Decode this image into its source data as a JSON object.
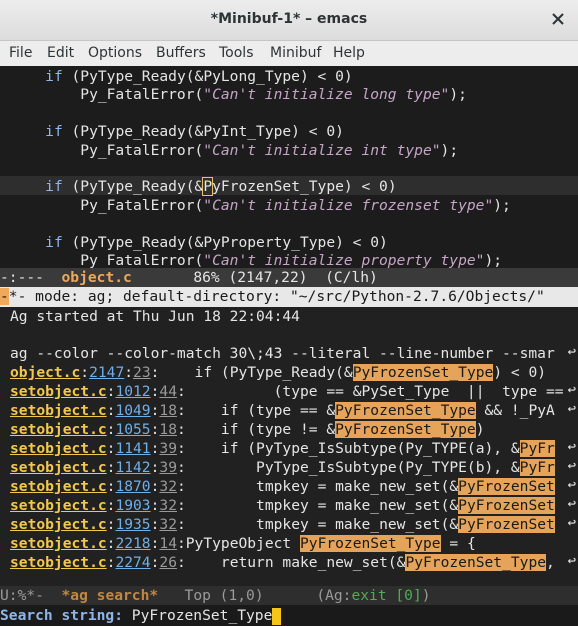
{
  "window": {
    "title": "*Minibuf-1* – emacs",
    "close_icon": "close-icon"
  },
  "menu": [
    "File",
    "Edit",
    "Options",
    "Buffers",
    "Tools",
    "Minibuf",
    "Help"
  ],
  "top_buffer": {
    "lines": [
      {
        "indent": "    ",
        "kw": "if",
        "rest": " (PyType_Ready(&PyLong_Type) < 0)"
      },
      {
        "indent": "        ",
        "fn": "Py_FatalError(",
        "str": "\"Can't initialize long type\"",
        "tail": ");"
      },
      {
        "blank": true
      },
      {
        "indent": "    ",
        "kw": "if",
        "rest": " (PyType_Ready(&PyInt_Type) < 0)"
      },
      {
        "indent": "        ",
        "fn": "Py_FatalError(",
        "str": "\"Can't initialize int type\"",
        "tail": ");"
      },
      {
        "blank": true
      },
      {
        "indent": "    ",
        "kw": "if",
        "rest": " (PyType_Ready(&PyFrozenSet_Type) < 0)"
      },
      {
        "indent": "        ",
        "fn": "Py_FatalError(",
        "str": "\"Can't initialize frozenset type\"",
        "tail": ");"
      },
      {
        "blank": true
      },
      {
        "indent": "    ",
        "kw": "if",
        "rest": " (PyType_Ready(&PyProperty_Type) < 0)"
      },
      {
        "indent": "        ",
        "fn": "Py_FatalError(",
        "str": "\"Can't initialize property type\"",
        "tail": ");"
      }
    ],
    "modeline": {
      "prefix": "-:---  ",
      "name": "object.c",
      "rest": "       86% (2147,22)  (C/lh)"
    }
  },
  "ag_buffer": {
    "header": "-*- mode: ag; default-directory: \"~/src/Python-2.7.6/Objects/\"",
    "header_cursor": "-",
    "header_rest": "*- mode: ag; default-directory: \"~/src/Python-2.7.6/Objects/\"",
    "started": "Ag started at Thu Jun 18 22:04:44",
    "command": "ag --color --color-match 30\\;43 --literal --line-number --smar",
    "results": [
      {
        "file": "object.c",
        "line": "2147",
        "col": "23",
        "pre": ":    if (PyType_Ready(&",
        "match": "PyFrozenSet_Type",
        "post": ") < 0)"
      },
      {
        "file": "setobject.c",
        "line": "1012",
        "col": "44",
        "pre": ":          (type == &PySet_Type  ||  type ==",
        "match": "",
        "post": ""
      },
      {
        "file": "setobject.c",
        "line": "1049",
        "col": "18",
        "pre": ":    if (type == &",
        "match": "PyFrozenSet_Type",
        "post": " && !_PyA"
      },
      {
        "file": "setobject.c",
        "line": "1055",
        "col": "18",
        "pre": ":    if (type != &",
        "match": "PyFrozenSet_Type",
        "post": ")"
      },
      {
        "file": "setobject.c",
        "line": "1141",
        "col": "39",
        "pre": ":    if (PyType_IsSubtype(Py_TYPE(a), &",
        "match": "PyFr",
        "post": ""
      },
      {
        "file": "setobject.c",
        "line": "1142",
        "col": "39",
        "pre": ":        PyType_IsSubtype(Py_TYPE(b), &",
        "match": "PyFr",
        "post": ""
      },
      {
        "file": "setobject.c",
        "line": "1870",
        "col": "32",
        "pre": ":        tmpkey = make_new_set(&",
        "match": "PyFrozenSet",
        "post": ""
      },
      {
        "file": "setobject.c",
        "line": "1903",
        "col": "32",
        "pre": ":        tmpkey = make_new_set(&",
        "match": "PyFrozenSet",
        "post": ""
      },
      {
        "file": "setobject.c",
        "line": "1935",
        "col": "32",
        "pre": ":        tmpkey = make_new_set(&",
        "match": "PyFrozenSet",
        "post": ""
      },
      {
        "file": "setobject.c",
        "line": "2218",
        "col": "14",
        "pre": ":PyTypeObject ",
        "match": "PyFrozenSet_Type",
        "post": " = {"
      },
      {
        "file": "setobject.c",
        "line": "2274",
        "col": "26",
        "pre": ":    return make_new_set(&",
        "match": "PyFrozenSet_Type",
        "post": ","
      }
    ],
    "modeline": {
      "prefix": "U:%*-  ",
      "name": "*ag search*",
      "rest": "   Top (1,0)      (Ag:",
      "status": "exit [0]",
      "close": ")"
    }
  },
  "minibuffer": {
    "prompt": "Search string: ",
    "value": "PyFrozenSet_Type"
  }
}
